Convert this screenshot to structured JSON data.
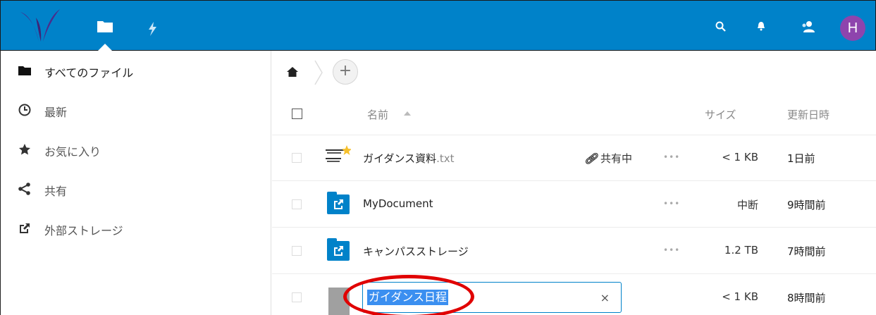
{
  "header": {
    "app_logo": "nextcloud-logo",
    "nav_files_icon": "folder-icon",
    "nav_activity_icon": "lightning-icon",
    "search_icon": "search-icon",
    "notifications_icon": "bell-icon",
    "contacts_icon": "contacts-icon",
    "avatar_initial": "H",
    "brand_color": "#0082c9",
    "avatar_color": "#8e44ad"
  },
  "sidebar": {
    "items": [
      {
        "label": "すべてのファイル",
        "icon": "folder-icon",
        "active": true
      },
      {
        "label": "最新",
        "icon": "clock-icon"
      },
      {
        "label": "お気に入り",
        "icon": "star-icon"
      },
      {
        "label": "共有",
        "icon": "share-icon"
      },
      {
        "label": "外部ストレージ",
        "icon": "external-link-icon"
      }
    ]
  },
  "breadcrumb": {
    "home_icon": "home-icon",
    "add_label": "+"
  },
  "table": {
    "headers": {
      "name": "名前",
      "size": "サイズ",
      "modified": "更新日時"
    },
    "rows": [
      {
        "name": "ガイダンス資料",
        "ext": ".txt",
        "share": "共有中",
        "more": "•••",
        "size": "< 1 KB",
        "modified": "1日前"
      },
      {
        "name": "MyDocument",
        "ext": "",
        "share": "",
        "more": "•••",
        "size": "中断",
        "modified": "9時間前"
      },
      {
        "name": "キャンパスストレージ",
        "ext": "",
        "share": "",
        "more": "•••",
        "size": "1.2 TB",
        "modified": "7時間前"
      },
      {
        "name": "ガイダンス日程",
        "ext": "",
        "share": "",
        "more": "",
        "size": "< 1 KB",
        "modified": "8時間前",
        "renaming": true,
        "clear_label": "×"
      }
    ]
  }
}
